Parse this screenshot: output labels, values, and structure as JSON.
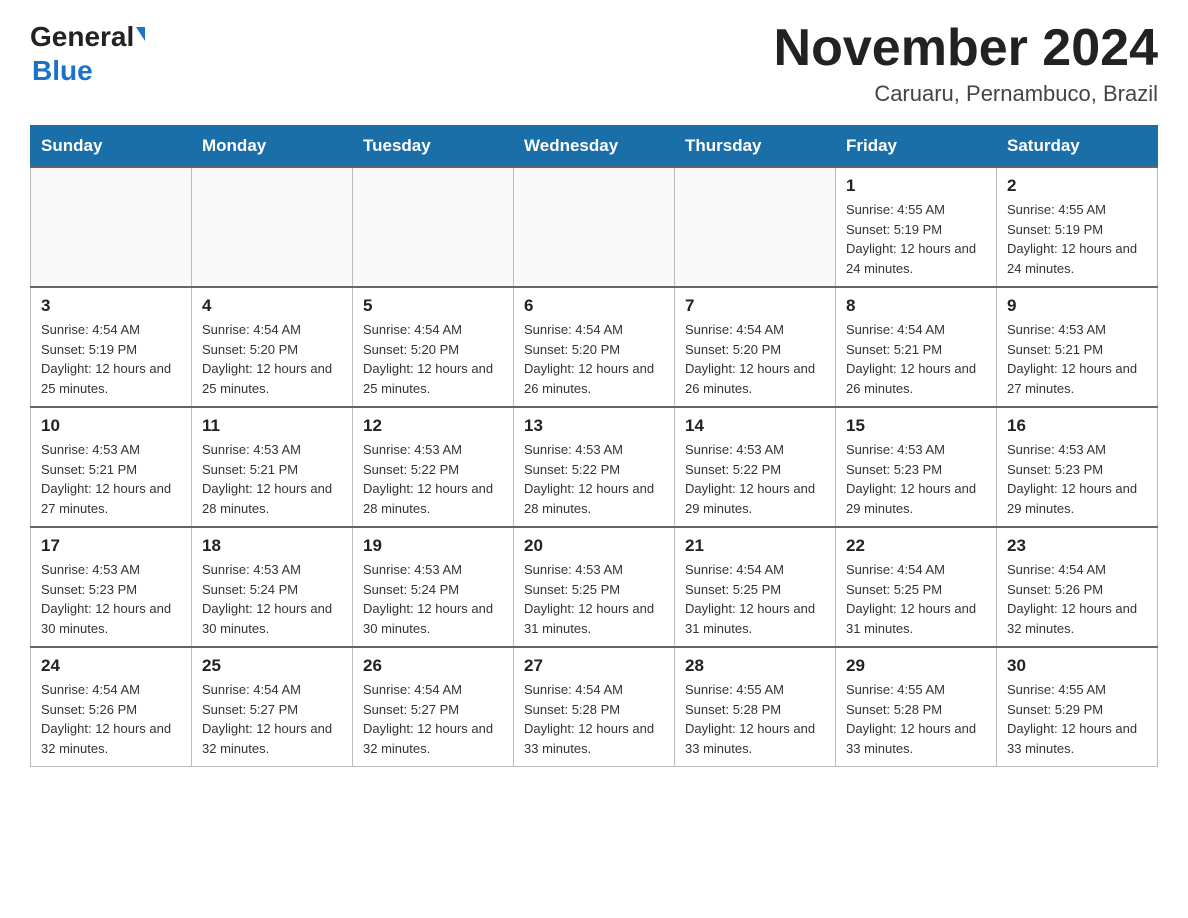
{
  "header": {
    "logo_general": "General",
    "logo_blue": "Blue",
    "title": "November 2024",
    "subtitle": "Caruaru, Pernambuco, Brazil"
  },
  "days_of_week": [
    "Sunday",
    "Monday",
    "Tuesday",
    "Wednesday",
    "Thursday",
    "Friday",
    "Saturday"
  ],
  "weeks": [
    [
      {
        "day": "",
        "sunrise": "",
        "sunset": "",
        "daylight": "",
        "empty": true
      },
      {
        "day": "",
        "sunrise": "",
        "sunset": "",
        "daylight": "",
        "empty": true
      },
      {
        "day": "",
        "sunrise": "",
        "sunset": "",
        "daylight": "",
        "empty": true
      },
      {
        "day": "",
        "sunrise": "",
        "sunset": "",
        "daylight": "",
        "empty": true
      },
      {
        "day": "",
        "sunrise": "",
        "sunset": "",
        "daylight": "",
        "empty": true
      },
      {
        "day": "1",
        "sunrise": "Sunrise: 4:55 AM",
        "sunset": "Sunset: 5:19 PM",
        "daylight": "Daylight: 12 hours and 24 minutes."
      },
      {
        "day": "2",
        "sunrise": "Sunrise: 4:55 AM",
        "sunset": "Sunset: 5:19 PM",
        "daylight": "Daylight: 12 hours and 24 minutes."
      }
    ],
    [
      {
        "day": "3",
        "sunrise": "Sunrise: 4:54 AM",
        "sunset": "Sunset: 5:19 PM",
        "daylight": "Daylight: 12 hours and 25 minutes."
      },
      {
        "day": "4",
        "sunrise": "Sunrise: 4:54 AM",
        "sunset": "Sunset: 5:20 PM",
        "daylight": "Daylight: 12 hours and 25 minutes."
      },
      {
        "day": "5",
        "sunrise": "Sunrise: 4:54 AM",
        "sunset": "Sunset: 5:20 PM",
        "daylight": "Daylight: 12 hours and 25 minutes."
      },
      {
        "day": "6",
        "sunrise": "Sunrise: 4:54 AM",
        "sunset": "Sunset: 5:20 PM",
        "daylight": "Daylight: 12 hours and 26 minutes."
      },
      {
        "day": "7",
        "sunrise": "Sunrise: 4:54 AM",
        "sunset": "Sunset: 5:20 PM",
        "daylight": "Daylight: 12 hours and 26 minutes."
      },
      {
        "day": "8",
        "sunrise": "Sunrise: 4:54 AM",
        "sunset": "Sunset: 5:21 PM",
        "daylight": "Daylight: 12 hours and 26 minutes."
      },
      {
        "day": "9",
        "sunrise": "Sunrise: 4:53 AM",
        "sunset": "Sunset: 5:21 PM",
        "daylight": "Daylight: 12 hours and 27 minutes."
      }
    ],
    [
      {
        "day": "10",
        "sunrise": "Sunrise: 4:53 AM",
        "sunset": "Sunset: 5:21 PM",
        "daylight": "Daylight: 12 hours and 27 minutes."
      },
      {
        "day": "11",
        "sunrise": "Sunrise: 4:53 AM",
        "sunset": "Sunset: 5:21 PM",
        "daylight": "Daylight: 12 hours and 28 minutes."
      },
      {
        "day": "12",
        "sunrise": "Sunrise: 4:53 AM",
        "sunset": "Sunset: 5:22 PM",
        "daylight": "Daylight: 12 hours and 28 minutes."
      },
      {
        "day": "13",
        "sunrise": "Sunrise: 4:53 AM",
        "sunset": "Sunset: 5:22 PM",
        "daylight": "Daylight: 12 hours and 28 minutes."
      },
      {
        "day": "14",
        "sunrise": "Sunrise: 4:53 AM",
        "sunset": "Sunset: 5:22 PM",
        "daylight": "Daylight: 12 hours and 29 minutes."
      },
      {
        "day": "15",
        "sunrise": "Sunrise: 4:53 AM",
        "sunset": "Sunset: 5:23 PM",
        "daylight": "Daylight: 12 hours and 29 minutes."
      },
      {
        "day": "16",
        "sunrise": "Sunrise: 4:53 AM",
        "sunset": "Sunset: 5:23 PM",
        "daylight": "Daylight: 12 hours and 29 minutes."
      }
    ],
    [
      {
        "day": "17",
        "sunrise": "Sunrise: 4:53 AM",
        "sunset": "Sunset: 5:23 PM",
        "daylight": "Daylight: 12 hours and 30 minutes."
      },
      {
        "day": "18",
        "sunrise": "Sunrise: 4:53 AM",
        "sunset": "Sunset: 5:24 PM",
        "daylight": "Daylight: 12 hours and 30 minutes."
      },
      {
        "day": "19",
        "sunrise": "Sunrise: 4:53 AM",
        "sunset": "Sunset: 5:24 PM",
        "daylight": "Daylight: 12 hours and 30 minutes."
      },
      {
        "day": "20",
        "sunrise": "Sunrise: 4:53 AM",
        "sunset": "Sunset: 5:25 PM",
        "daylight": "Daylight: 12 hours and 31 minutes."
      },
      {
        "day": "21",
        "sunrise": "Sunrise: 4:54 AM",
        "sunset": "Sunset: 5:25 PM",
        "daylight": "Daylight: 12 hours and 31 minutes."
      },
      {
        "day": "22",
        "sunrise": "Sunrise: 4:54 AM",
        "sunset": "Sunset: 5:25 PM",
        "daylight": "Daylight: 12 hours and 31 minutes."
      },
      {
        "day": "23",
        "sunrise": "Sunrise: 4:54 AM",
        "sunset": "Sunset: 5:26 PM",
        "daylight": "Daylight: 12 hours and 32 minutes."
      }
    ],
    [
      {
        "day": "24",
        "sunrise": "Sunrise: 4:54 AM",
        "sunset": "Sunset: 5:26 PM",
        "daylight": "Daylight: 12 hours and 32 minutes."
      },
      {
        "day": "25",
        "sunrise": "Sunrise: 4:54 AM",
        "sunset": "Sunset: 5:27 PM",
        "daylight": "Daylight: 12 hours and 32 minutes."
      },
      {
        "day": "26",
        "sunrise": "Sunrise: 4:54 AM",
        "sunset": "Sunset: 5:27 PM",
        "daylight": "Daylight: 12 hours and 32 minutes."
      },
      {
        "day": "27",
        "sunrise": "Sunrise: 4:54 AM",
        "sunset": "Sunset: 5:28 PM",
        "daylight": "Daylight: 12 hours and 33 minutes."
      },
      {
        "day": "28",
        "sunrise": "Sunrise: 4:55 AM",
        "sunset": "Sunset: 5:28 PM",
        "daylight": "Daylight: 12 hours and 33 minutes."
      },
      {
        "day": "29",
        "sunrise": "Sunrise: 4:55 AM",
        "sunset": "Sunset: 5:28 PM",
        "daylight": "Daylight: 12 hours and 33 minutes."
      },
      {
        "day": "30",
        "sunrise": "Sunrise: 4:55 AM",
        "sunset": "Sunset: 5:29 PM",
        "daylight": "Daylight: 12 hours and 33 minutes."
      }
    ]
  ]
}
